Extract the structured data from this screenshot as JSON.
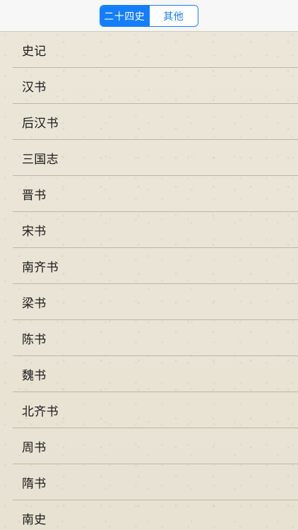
{
  "segmented_control": {
    "segments": [
      {
        "label": "二十四史",
        "active": true
      },
      {
        "label": "其他",
        "active": false
      }
    ]
  },
  "book_list": [
    "史记",
    "汉书",
    "后汉书",
    "三国志",
    "晋书",
    "宋书",
    "南齐书",
    "梁书",
    "陈书",
    "魏书",
    "北齐书",
    "周书",
    "隋书",
    "南史"
  ],
  "colors": {
    "accent": "#157efb",
    "background": "#ece7da",
    "topbar": "#f7f7f7"
  }
}
